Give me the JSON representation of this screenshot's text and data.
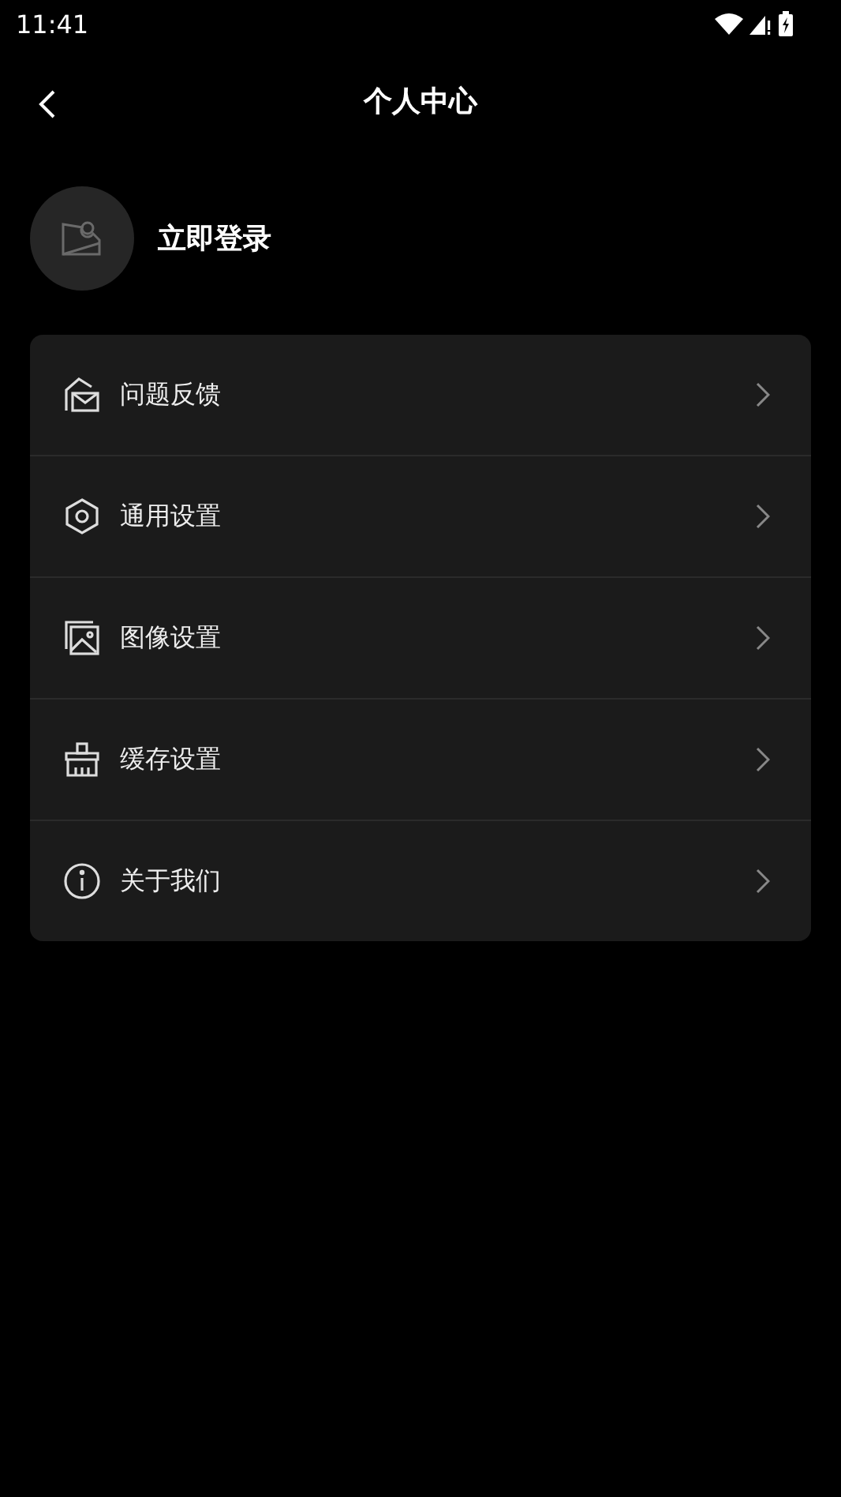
{
  "status_bar": {
    "time": "11:41"
  },
  "header": {
    "title": "个人中心"
  },
  "profile": {
    "login_label": "立即登录"
  },
  "menu": [
    {
      "kind": "feedback",
      "label": "问题反馈"
    },
    {
      "kind": "general",
      "label": "通用设置"
    },
    {
      "kind": "image",
      "label": "图像设置"
    },
    {
      "kind": "cache",
      "label": "缓存设置"
    },
    {
      "kind": "about",
      "label": "关于我们"
    }
  ]
}
